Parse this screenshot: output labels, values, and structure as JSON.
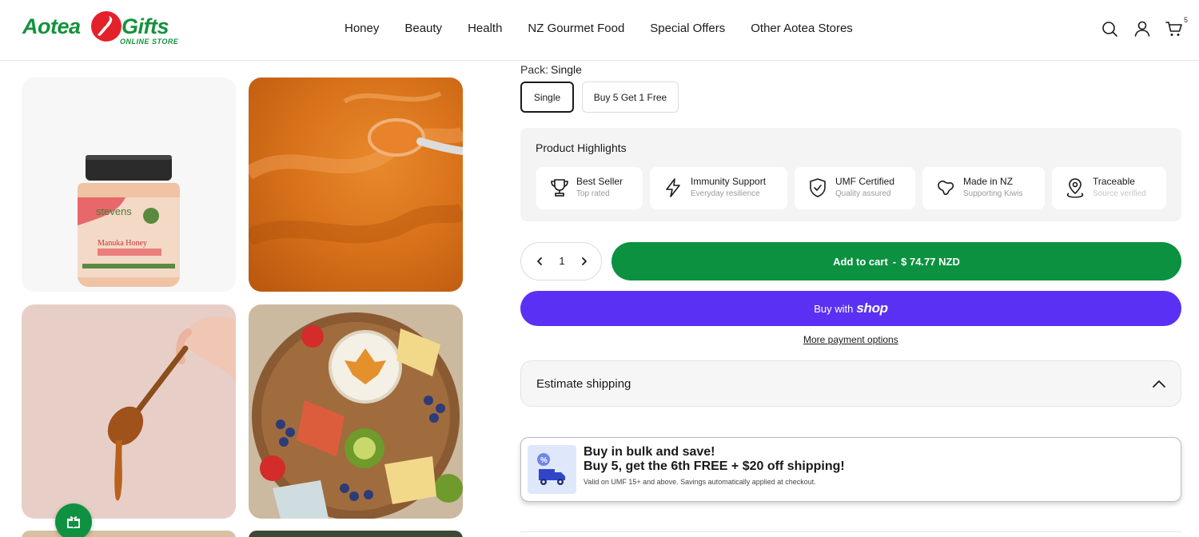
{
  "brand": {
    "logo_left": "Aotea",
    "logo_right": "Gifts",
    "logo_sub": "ONLINE STORE",
    "primary_color": "#14923c",
    "accent_color": "#e4212b"
  },
  "nav": {
    "items": [
      "Honey",
      "Beauty",
      "Health",
      "NZ Gourmet Food",
      "Special Offers",
      "Other Aotea Stores"
    ]
  },
  "header_icons": {
    "search": "search-icon",
    "account": "user-icon",
    "cart": "cart-icon",
    "cart_count": "5"
  },
  "gallery": {
    "images": [
      "manuka-honey-jar",
      "honey-texture-spoon",
      "hand-holding-honey-spoon",
      "cheese-board-with-honey",
      "partial-image",
      "partial-image"
    ]
  },
  "product": {
    "pack_label": "Pack:",
    "pack_value": "Single",
    "options": [
      "Single",
      "Buy 5 Get 1 Free"
    ],
    "selected_option": "Single"
  },
  "highlights": {
    "title": "Product Highlights",
    "items": [
      {
        "name": "Best Seller",
        "sub": "Top rated",
        "icon": "trophy-icon"
      },
      {
        "name": "Immunity Support",
        "sub": "Everyday resilience",
        "icon": "lightning-icon"
      },
      {
        "name": "UMF Certified",
        "sub": "Quality assured",
        "icon": "shield-check-icon"
      },
      {
        "name": "Made in NZ",
        "sub": "Supporting Kiwis",
        "icon": "nz-map-icon"
      },
      {
        "name": "Traceable",
        "sub": "Source verified",
        "icon": "location-pin-icon"
      }
    ]
  },
  "purchase": {
    "quantity": "1",
    "add_to_cart": "Add to cart",
    "separator": "-",
    "price": "$ 74.77 NZD",
    "buy_with": "Buy with",
    "shop_word": "shop",
    "more_payment": "More payment options",
    "cart_color": "#0c9140",
    "shop_color": "#5a31f4"
  },
  "shipping": {
    "label": "Estimate shipping"
  },
  "promo": {
    "line1": "Buy in bulk and save!",
    "line2": "Buy 5, get the 6th FREE + $20 off shipping!",
    "line3": "Valid on UMF 15+ and above. Savings automatically applied at checkout.",
    "icon": "delivery-truck-discount-icon"
  },
  "gift_button": {
    "icon": "gift-icon"
  }
}
